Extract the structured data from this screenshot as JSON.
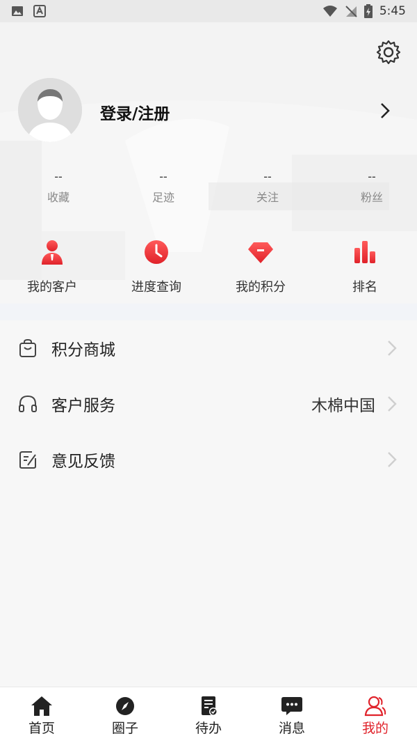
{
  "status_bar": {
    "time": "5:45"
  },
  "profile": {
    "login_label": "登录/注册"
  },
  "stats": [
    {
      "value": "--",
      "label": "收藏"
    },
    {
      "value": "--",
      "label": "足迹"
    },
    {
      "value": "--",
      "label": "关注"
    },
    {
      "value": "--",
      "label": "粉丝"
    }
  ],
  "quick_actions": [
    {
      "label": "我的客户",
      "icon": "customer-icon"
    },
    {
      "label": "进度查询",
      "icon": "clock-icon"
    },
    {
      "label": "我的积分",
      "icon": "diamond-icon"
    },
    {
      "label": "排名",
      "icon": "bar-chart-icon"
    }
  ],
  "menu": [
    {
      "label": "积分商城",
      "value": "",
      "icon": "shopping-bag-icon"
    },
    {
      "label": "客户服务",
      "value": "木棉中国",
      "icon": "headphones-icon"
    },
    {
      "label": "意见反馈",
      "value": "",
      "icon": "feedback-icon"
    }
  ],
  "bottom_nav": [
    {
      "label": "首页",
      "icon": "home-icon"
    },
    {
      "label": "圈子",
      "icon": "compass-icon"
    },
    {
      "label": "待办",
      "icon": "todo-icon"
    },
    {
      "label": "消息",
      "icon": "message-icon"
    },
    {
      "label": "我的",
      "icon": "user-icon",
      "active": true
    }
  ],
  "colors": {
    "accent": "#e0222a",
    "accent_light": "#ff5a5a"
  }
}
